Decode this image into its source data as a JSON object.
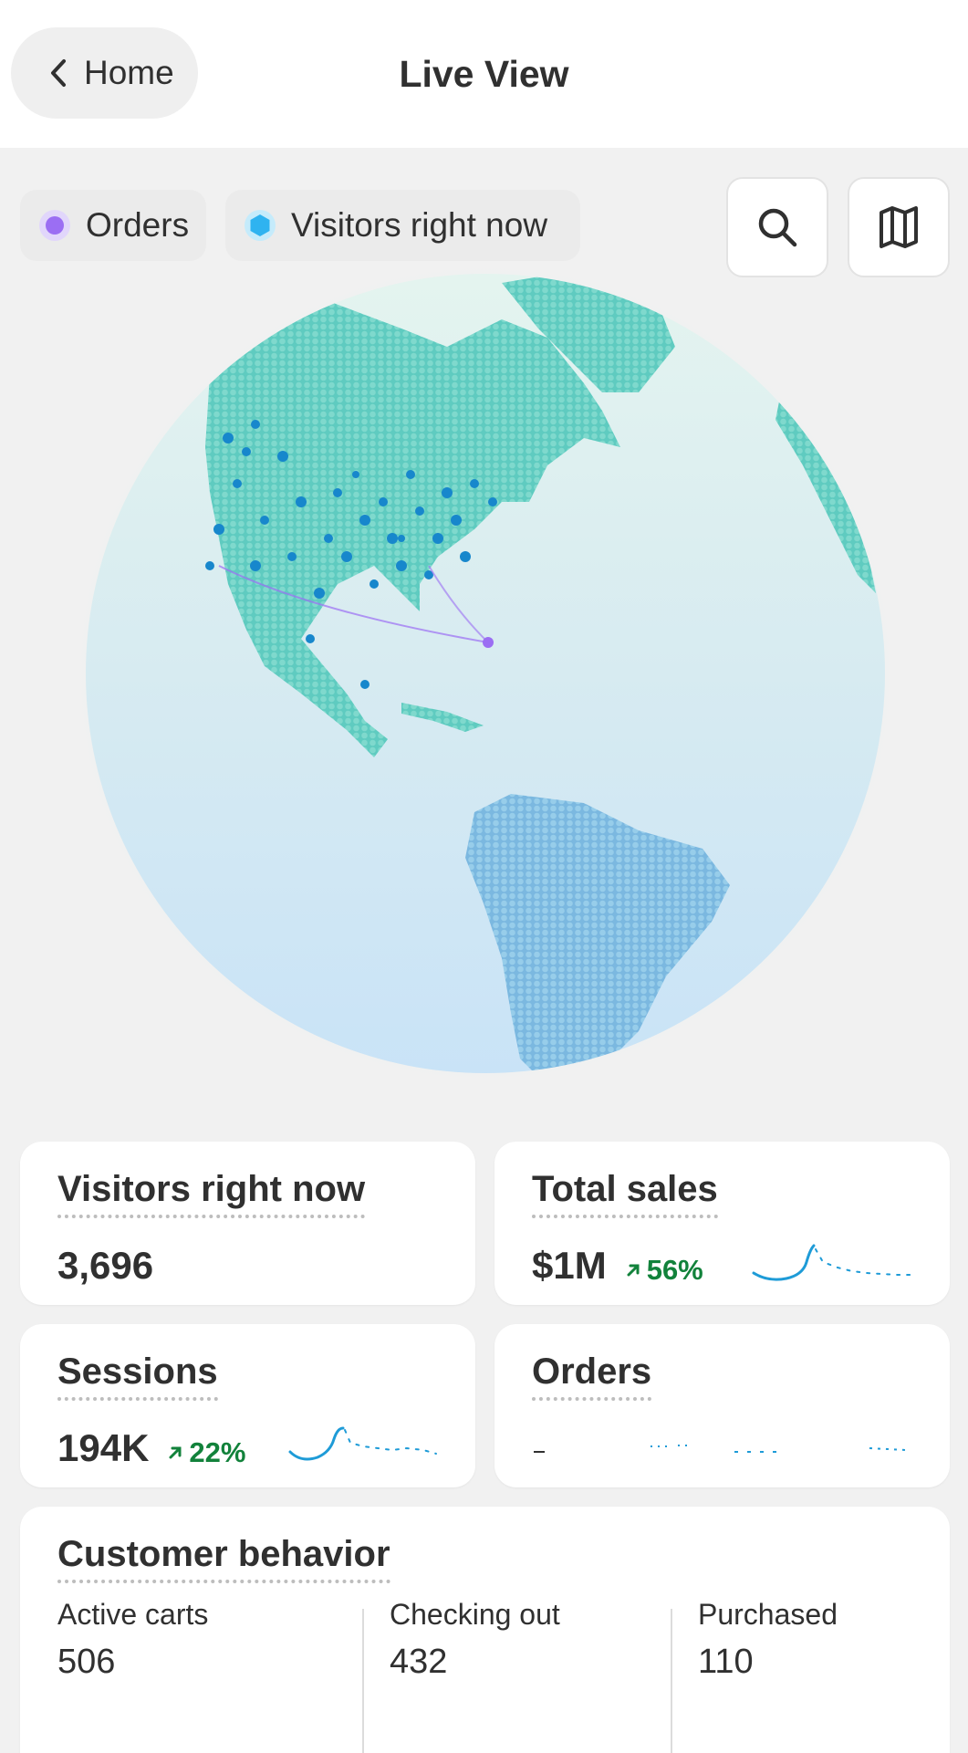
{
  "header": {
    "back_label": "Home",
    "title": "Live View"
  },
  "legend": {
    "orders_label": "Orders",
    "visitors_label": "Visitors right now"
  },
  "colors": {
    "orders_dot": "#9b6ef3",
    "visitors_dot": "#2fb3f0",
    "trend_up": "#12823b",
    "spark": "#1e9bd7"
  },
  "icons": {
    "back": "chevron-left-icon",
    "search": "search-icon",
    "map": "map-icon"
  },
  "cards": {
    "visitors": {
      "title": "Visitors right now",
      "value": "3,696"
    },
    "total_sales": {
      "title": "Total sales",
      "value": "$1M",
      "change": "56%"
    },
    "sessions": {
      "title": "Sessions",
      "value": "194K",
      "change": "22%"
    },
    "orders": {
      "title": "Orders"
    }
  },
  "customer_behavior": {
    "title": "Customer behavior",
    "stats": [
      {
        "label": "Active carts",
        "value": "506"
      },
      {
        "label": "Checking out",
        "value": "432"
      },
      {
        "label": "Purchased",
        "value": "110"
      }
    ]
  }
}
